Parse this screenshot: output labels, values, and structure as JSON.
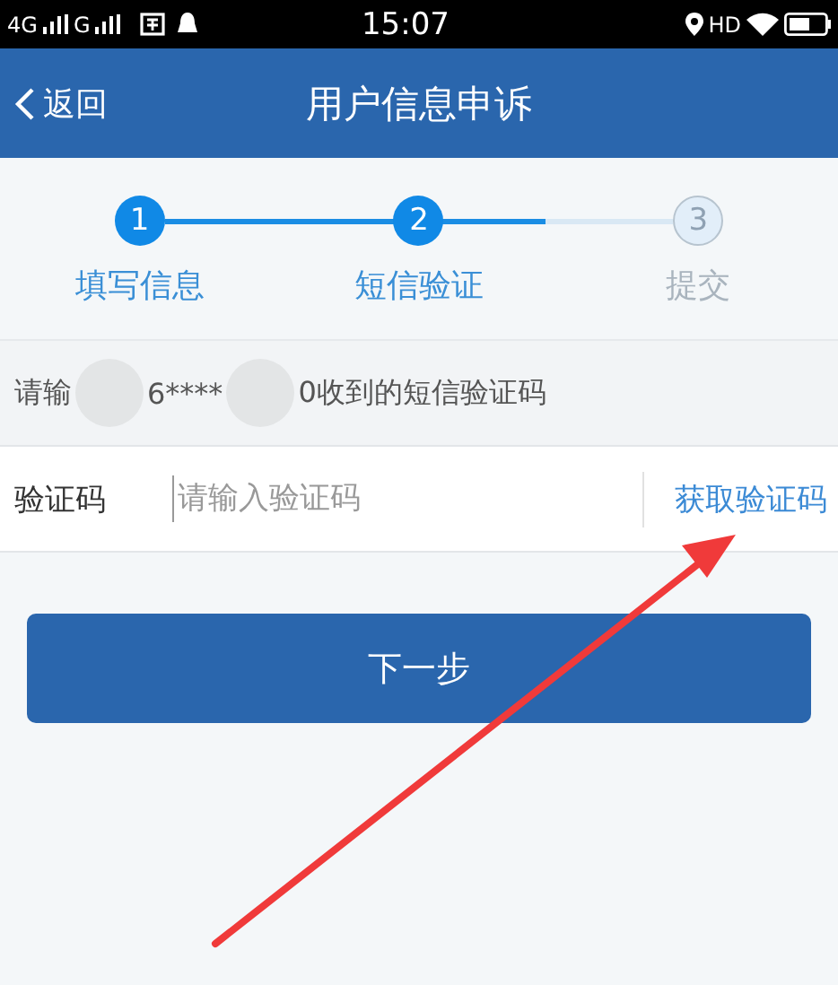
{
  "status_bar": {
    "network_1": "4G",
    "network_2": "G",
    "time": "15:07",
    "hd": "HD"
  },
  "nav": {
    "back": "返回",
    "title": "用户信息申诉"
  },
  "steps": {
    "level": 0.75,
    "items": [
      {
        "number": "1",
        "label": "填写信息",
        "active": true
      },
      {
        "number": "2",
        "label": "短信验证",
        "active": true
      },
      {
        "number": "3",
        "label": "提交",
        "active": false
      }
    ]
  },
  "hint_parts": [
    "请输",
    "6****",
    "0收到的短信验证码"
  ],
  "code_field": {
    "label": "验证码",
    "placeholder": "请输入验证码",
    "action": "获取验证码"
  },
  "next_button": "下一步"
}
